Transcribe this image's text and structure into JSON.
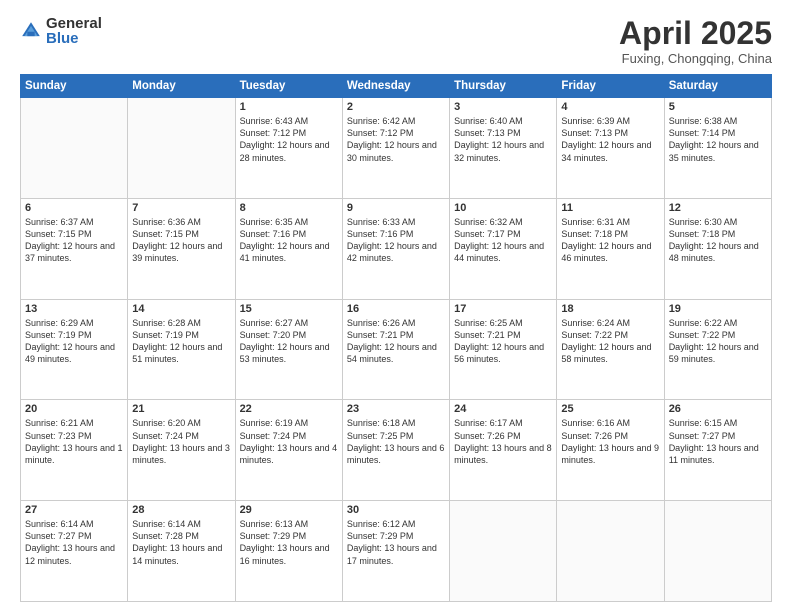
{
  "logo": {
    "general": "General",
    "blue": "Blue"
  },
  "header": {
    "month": "April 2025",
    "location": "Fuxing, Chongqing, China"
  },
  "days_of_week": [
    "Sunday",
    "Monday",
    "Tuesday",
    "Wednesday",
    "Thursday",
    "Friday",
    "Saturday"
  ],
  "weeks": [
    [
      {
        "day": "",
        "info": ""
      },
      {
        "day": "",
        "info": ""
      },
      {
        "day": "1",
        "info": "Sunrise: 6:43 AM\nSunset: 7:12 PM\nDaylight: 12 hours and 28 minutes."
      },
      {
        "day": "2",
        "info": "Sunrise: 6:42 AM\nSunset: 7:12 PM\nDaylight: 12 hours and 30 minutes."
      },
      {
        "day": "3",
        "info": "Sunrise: 6:40 AM\nSunset: 7:13 PM\nDaylight: 12 hours and 32 minutes."
      },
      {
        "day": "4",
        "info": "Sunrise: 6:39 AM\nSunset: 7:13 PM\nDaylight: 12 hours and 34 minutes."
      },
      {
        "day": "5",
        "info": "Sunrise: 6:38 AM\nSunset: 7:14 PM\nDaylight: 12 hours and 35 minutes."
      }
    ],
    [
      {
        "day": "6",
        "info": "Sunrise: 6:37 AM\nSunset: 7:15 PM\nDaylight: 12 hours and 37 minutes."
      },
      {
        "day": "7",
        "info": "Sunrise: 6:36 AM\nSunset: 7:15 PM\nDaylight: 12 hours and 39 minutes."
      },
      {
        "day": "8",
        "info": "Sunrise: 6:35 AM\nSunset: 7:16 PM\nDaylight: 12 hours and 41 minutes."
      },
      {
        "day": "9",
        "info": "Sunrise: 6:33 AM\nSunset: 7:16 PM\nDaylight: 12 hours and 42 minutes."
      },
      {
        "day": "10",
        "info": "Sunrise: 6:32 AM\nSunset: 7:17 PM\nDaylight: 12 hours and 44 minutes."
      },
      {
        "day": "11",
        "info": "Sunrise: 6:31 AM\nSunset: 7:18 PM\nDaylight: 12 hours and 46 minutes."
      },
      {
        "day": "12",
        "info": "Sunrise: 6:30 AM\nSunset: 7:18 PM\nDaylight: 12 hours and 48 minutes."
      }
    ],
    [
      {
        "day": "13",
        "info": "Sunrise: 6:29 AM\nSunset: 7:19 PM\nDaylight: 12 hours and 49 minutes."
      },
      {
        "day": "14",
        "info": "Sunrise: 6:28 AM\nSunset: 7:19 PM\nDaylight: 12 hours and 51 minutes."
      },
      {
        "day": "15",
        "info": "Sunrise: 6:27 AM\nSunset: 7:20 PM\nDaylight: 12 hours and 53 minutes."
      },
      {
        "day": "16",
        "info": "Sunrise: 6:26 AM\nSunset: 7:21 PM\nDaylight: 12 hours and 54 minutes."
      },
      {
        "day": "17",
        "info": "Sunrise: 6:25 AM\nSunset: 7:21 PM\nDaylight: 12 hours and 56 minutes."
      },
      {
        "day": "18",
        "info": "Sunrise: 6:24 AM\nSunset: 7:22 PM\nDaylight: 12 hours and 58 minutes."
      },
      {
        "day": "19",
        "info": "Sunrise: 6:22 AM\nSunset: 7:22 PM\nDaylight: 12 hours and 59 minutes."
      }
    ],
    [
      {
        "day": "20",
        "info": "Sunrise: 6:21 AM\nSunset: 7:23 PM\nDaylight: 13 hours and 1 minute."
      },
      {
        "day": "21",
        "info": "Sunrise: 6:20 AM\nSunset: 7:24 PM\nDaylight: 13 hours and 3 minutes."
      },
      {
        "day": "22",
        "info": "Sunrise: 6:19 AM\nSunset: 7:24 PM\nDaylight: 13 hours and 4 minutes."
      },
      {
        "day": "23",
        "info": "Sunrise: 6:18 AM\nSunset: 7:25 PM\nDaylight: 13 hours and 6 minutes."
      },
      {
        "day": "24",
        "info": "Sunrise: 6:17 AM\nSunset: 7:26 PM\nDaylight: 13 hours and 8 minutes."
      },
      {
        "day": "25",
        "info": "Sunrise: 6:16 AM\nSunset: 7:26 PM\nDaylight: 13 hours and 9 minutes."
      },
      {
        "day": "26",
        "info": "Sunrise: 6:15 AM\nSunset: 7:27 PM\nDaylight: 13 hours and 11 minutes."
      }
    ],
    [
      {
        "day": "27",
        "info": "Sunrise: 6:14 AM\nSunset: 7:27 PM\nDaylight: 13 hours and 12 minutes."
      },
      {
        "day": "28",
        "info": "Sunrise: 6:14 AM\nSunset: 7:28 PM\nDaylight: 13 hours and 14 minutes."
      },
      {
        "day": "29",
        "info": "Sunrise: 6:13 AM\nSunset: 7:29 PM\nDaylight: 13 hours and 16 minutes."
      },
      {
        "day": "30",
        "info": "Sunrise: 6:12 AM\nSunset: 7:29 PM\nDaylight: 13 hours and 17 minutes."
      },
      {
        "day": "",
        "info": ""
      },
      {
        "day": "",
        "info": ""
      },
      {
        "day": "",
        "info": ""
      }
    ]
  ]
}
